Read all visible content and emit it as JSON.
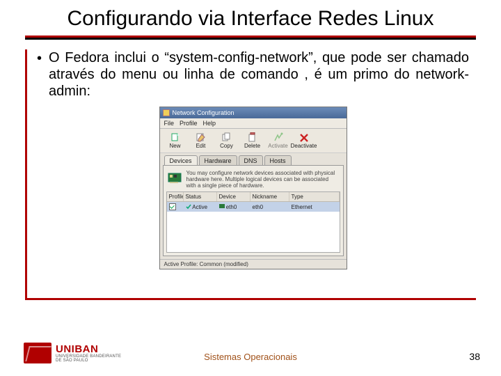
{
  "slide": {
    "title": "Configurando via Interface Redes Linux",
    "bullet": "O Fedora inclui o “system-config-network”, que pode ser chamado através do menu ou linha de comando , é um primo do network-admin:",
    "footer": "Sistemas Operacionais",
    "page": "38",
    "logo_brand": "UNIBAN",
    "logo_sub1": "UNIVERSIDADE BANDEIRANTE",
    "logo_sub2": "DE SÃO PAULO"
  },
  "window": {
    "title": "Network Configuration",
    "menus": {
      "file": "File",
      "profile": "Profile",
      "help": "Help"
    },
    "toolbar": {
      "new": "New",
      "edit": "Edit",
      "copy": "Copy",
      "delete": "Delete",
      "activate": "Activate",
      "deactivate": "Deactivate"
    },
    "tabs": {
      "devices": "Devices",
      "hardware": "Hardware",
      "dns": "DNS",
      "hosts": "Hosts"
    },
    "pane_desc": "You may configure network devices associated with physical hardware here. Multiple logical devices can be associated with a single piece of hardware.",
    "columns": {
      "profile": "Profile",
      "status": "Status",
      "device": "Device",
      "nickname": "Nickname",
      "type": "Type"
    },
    "row": {
      "status": "Active",
      "device": "eth0",
      "nickname": "eth0",
      "type": "Ethernet"
    },
    "statusbar": "Active Profile: Common (modified)"
  }
}
